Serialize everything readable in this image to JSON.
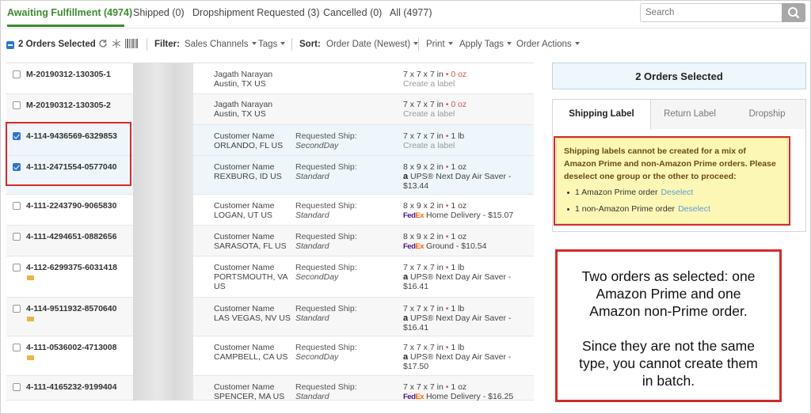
{
  "tabs": [
    {
      "label": "Awaiting Fulfillment (4974)"
    },
    {
      "label": "Shipped (0)"
    },
    {
      "label": "Dropshipment Requested (3)"
    },
    {
      "label": "Cancelled (0)"
    },
    {
      "label": "All (4977)"
    }
  ],
  "search": {
    "placeholder": "Search"
  },
  "toolbar": {
    "selected_label": "2 Orders Selected",
    "filter_label": "Filter:",
    "sales_channels": "Sales Channels",
    "tags": "Tags",
    "sort_label": "Sort:",
    "sort_value": "Order Date (Newest)",
    "print": "Print",
    "apply_tags": "Apply Tags",
    "order_actions": "Order Actions"
  },
  "orders": [
    {
      "id": "M-20190312-130305-1",
      "customer": "Jagath Narayan",
      "location": "Austin, TX US",
      "req_label": "",
      "req_service": "",
      "dims": "7 x 7 x 7 in",
      "weight": "0 oz",
      "line2": "Create a label",
      "carrier": "",
      "service": "",
      "price": "",
      "checked": false
    },
    {
      "id": "M-20190312-130305-2",
      "customer": "Jagath Narayan",
      "location": "Austin, TX US",
      "req_label": "",
      "req_service": "",
      "dims": "7 x 7 x 7 in",
      "weight": "0 oz",
      "line2": "Create a label",
      "carrier": "",
      "service": "",
      "price": "",
      "checked": false
    },
    {
      "id": "4-114-9436569-6329853",
      "customer": "Customer Name",
      "location": "ORLANDO, FL US",
      "req_label": "Requested Ship:",
      "req_service": "SecondDay",
      "dims": "7 x 7 x 7 in",
      "weight": "1 lb",
      "line2": "Create a label",
      "carrier": "",
      "service": "",
      "price": "",
      "checked": true
    },
    {
      "id": "4-111-2471554-0577040",
      "customer": "Customer Name",
      "location": "REXBURG, ID US",
      "req_label": "Requested Ship:",
      "req_service": "Standard",
      "dims": "8 x 9 x 2 in",
      "weight": "1 oz",
      "line2": "",
      "carrier": "amazon",
      "service": "UPS® Next Day Air Saver -",
      "price": "$13.44",
      "checked": true
    },
    {
      "id": "4-111-2243790-9065830",
      "customer": "Customer Name",
      "location": "LOGAN, UT US",
      "req_label": "Requested Ship:",
      "req_service": "Standard",
      "dims": "8 x 9 x 2 in",
      "weight": "1 oz",
      "line2": "",
      "carrier": "fedex",
      "service": "Home Delivery - $15.07",
      "price": "",
      "checked": false
    },
    {
      "id": "4-111-4294651-0882656",
      "customer": "Customer Name",
      "location": "SARASOTA, FL US",
      "req_label": "Requested Ship:",
      "req_service": "Standard",
      "dims": "8 x 9 x 2 in",
      "weight": "1 oz",
      "line2": "",
      "carrier": "fedex",
      "service": "Ground - $10.54",
      "price": "",
      "checked": false
    },
    {
      "id": "4-112-6299375-6031418",
      "customer": "Customer Name",
      "location": "PORTSMOUTH, VA US",
      "req_label": "Requested Ship:",
      "req_service": "SecondDay",
      "dims": "7 x 7 x 7 in",
      "weight": "1 lb",
      "line2": "",
      "carrier": "amazon",
      "service": "UPS® Next Day Air Saver -",
      "price": "$16.41",
      "checked": false
    },
    {
      "id": "4-114-9511932-8570640",
      "customer": "Customer Name",
      "location": "LAS VEGAS, NV US",
      "req_label": "Requested Ship:",
      "req_service": "Standard",
      "dims": "7 x 7 x 7 in",
      "weight": "1 lb",
      "line2": "",
      "carrier": "amazon",
      "service": "UPS® Next Day Air Saver -",
      "price": "$16.41",
      "checked": false
    },
    {
      "id": "4-111-0536002-4713008",
      "customer": "Customer Name",
      "location": "CAMPBELL, CA US",
      "req_label": "Requested Ship:",
      "req_service": "SecondDay",
      "dims": "7 x 7 x 7 in",
      "weight": "1 lb",
      "line2": "",
      "carrier": "amazon",
      "service": "UPS® Next Day Air Saver -",
      "price": "$17.50",
      "checked": false
    },
    {
      "id": "4-111-4165232-9199404",
      "customer": "Customer Name",
      "location": "SPENCER, MA US",
      "req_label": "Requested Ship:",
      "req_service": "Standard",
      "dims": "7 x 7 x 7 in",
      "weight": "1 oz",
      "line2": "",
      "carrier": "fedex",
      "service": "Home Delivery - $16.25",
      "price": "",
      "checked": false
    }
  ],
  "panel": {
    "selected_title": "2 Orders Selected",
    "tabs": [
      "Shipping Label",
      "Return Label",
      "Dropship"
    ],
    "warning": "Shipping labels cannot be created for a mix of Amazon Prime and non-Amazon Prime orders. Please deselect one group or the other to proceed:",
    "items": [
      {
        "label": "1 Amazon Prime order",
        "action": "Deselect"
      },
      {
        "label": "1 non-Amazon Prime order",
        "action": "Deselect"
      }
    ]
  },
  "annotation": {
    "p1": "Two orders as selected: one Amazon Prime and one Amazon non-Prime order.",
    "p2": "Since they are not the same type, you cannot create them in batch."
  },
  "colors": {
    "accent": "#3c8a2f",
    "selection": "#2f74c9",
    "highlight": "#d42a2a",
    "warning_bg": "#fdf7b6"
  }
}
